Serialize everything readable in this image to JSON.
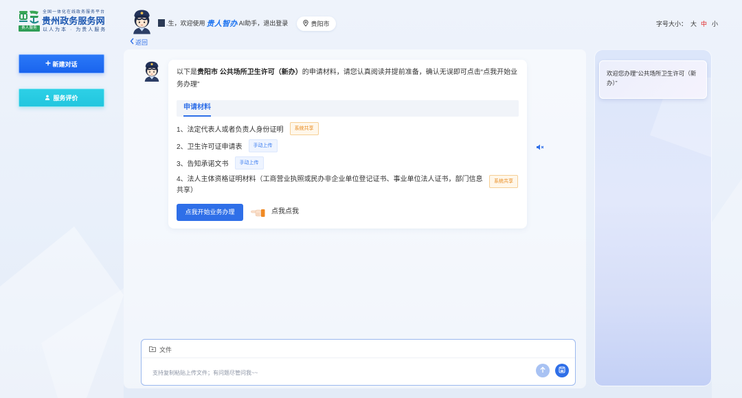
{
  "header": {
    "logo": {
      "badge": "贵人服务",
      "tagline": "全国一体化在线政务服务平台",
      "title": "贵州政务服务网",
      "slogan": "以人为本 · 为贵人服务"
    },
    "greeting": {
      "name_text": ".生，欢迎使用",
      "brand": "贵人智办",
      "assistant": "AI助手，",
      "logout": "退出登录"
    },
    "location": "贵阳市",
    "font_size": {
      "label": "字号大小：",
      "options": [
        "大",
        "中",
        "小"
      ],
      "active_index": 1
    },
    "back": "返回"
  },
  "sidebar": {
    "new_chat": "新建对话",
    "rating": "服务评价"
  },
  "chat": {
    "intro": {
      "prefix": "以下是",
      "highlight": "贵阳市 公共场所卫生许可（新办）",
      "suffix": "的申请材料，请您认真阅读并提前准备，确认无误即可点击“点我开始业务办理”"
    },
    "section_title": "申请材料",
    "materials": [
      {
        "text": "1、法定代表人或者负责人身份证明",
        "tag": "系统共享"
      },
      {
        "text": "2、卫生许可证申请表",
        "tag": "手动上传"
      },
      {
        "text": "3、告知承诺文书",
        "tag": "手动上传"
      },
      {
        "text": "4、法人主体资格证明材料（工商营业执照或民办非企业单位登记证书、事业单位法人证书，部门信息共享）",
        "tag": "系统共享"
      }
    ],
    "start_button": "点我开始业务办理",
    "hint": "点我点我"
  },
  "side_panel": {
    "welcome": "欢迎您办理“公共场所卫生许可（新办）”"
  },
  "composer": {
    "file_label": "文件",
    "placeholder": "支持复制粘贴上传文件；有问题尽管问我~~"
  },
  "icons": {
    "location": "map-pin-icon",
    "back": "chevron-left-icon",
    "new_chat": "plus-icon",
    "rating": "user-icon",
    "speaker": "speaker-mute-icon",
    "file": "folder-icon",
    "upload": "arrow-up-icon",
    "save": "save-icon",
    "pointer": "pointing-hand-icon"
  },
  "colors": {
    "primary": "#2f6fe8",
    "rating": "#22c6df",
    "active": "#e02020",
    "share": "#e8891c",
    "upload": "#3a7cf0",
    "brand": "#1c57b0"
  }
}
